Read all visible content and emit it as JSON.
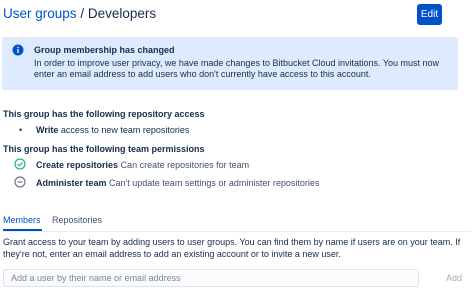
{
  "header": {
    "breadcrumb_link": "User groups",
    "separator": "/",
    "title": "Developers",
    "edit_label": "Edit"
  },
  "banner": {
    "icon": "info-icon",
    "title": "Group membership has changed",
    "message": "In order to improve user privacy, we have made changes to Bitbucket Cloud invitations. You must now enter an email address to add users who don't currently have access to this account."
  },
  "repo_access": {
    "heading": "This group has the following repository access",
    "items": [
      {
        "bullet": "•",
        "name": "Write",
        "description": "access to new team repositories"
      }
    ]
  },
  "team_permissions": {
    "heading": "This group has the following team permissions",
    "items": [
      {
        "icon": "check-circle-icon",
        "name": "Create repositories",
        "description": "Can create repositories for team",
        "granted": true,
        "color": "#36b37e"
      },
      {
        "icon": "minus-circle-icon",
        "name": "Administer team",
        "description": "Can't update team settings or administer repositories",
        "granted": false,
        "color": "#6b778c"
      }
    ]
  },
  "tabs": [
    {
      "label": "Members",
      "active": true
    },
    {
      "label": "Repositories",
      "active": false
    }
  ],
  "members": {
    "grant_text": "Grant access to your team by adding users to user groups. You can find them by name if users are on your team. If they're not, enter an email address to add an existing account or to invite a new user.",
    "input_placeholder": "Add a user by their name or email address",
    "input_value": "",
    "add_label": "Add"
  },
  "colors": {
    "accent": "#0052cc",
    "banner_bg": "#deebff",
    "text": "#172b4d"
  }
}
